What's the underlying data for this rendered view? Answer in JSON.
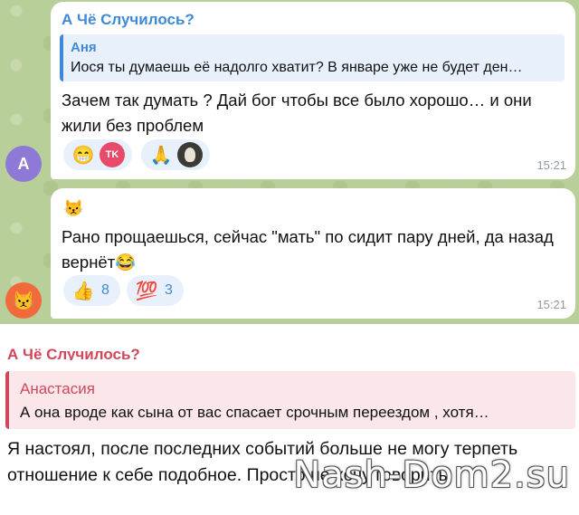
{
  "top_chat": {
    "message1": {
      "sender": "А Чё Случилось?",
      "reply_to_name": "Аня",
      "reply_to_text": "Иося ты думаешь её надолго хватит? В январе уже не будет ден…",
      "text": "Зачем так думать ? Дай бог чтобы все было хорошо… и они жили без проблем",
      "reactions": [
        {
          "icon": "grinning-face-icon",
          "glyph": "😁"
        },
        {
          "icon": "tk-sticker-icon",
          "glyph": "TK"
        },
        {
          "icon": "folded-hands-icon",
          "glyph": "🙏"
        },
        {
          "icon": "user-photo-icon",
          "glyph": ""
        }
      ],
      "time": "15:21",
      "avatar_letter": "A"
    },
    "message2": {
      "top_emoji": "😾",
      "text": "Рано прощаешься, сейчас \"мать\" по сидит пару дней, да назад вернёт😂",
      "reactions": [
        {
          "icon": "thumbs-up-icon",
          "glyph": "👍",
          "count": "8"
        },
        {
          "icon": "hundred-points-icon",
          "glyph": "💯",
          "count": "3"
        }
      ],
      "time": "15:21",
      "avatar_glyph": "😾"
    }
  },
  "bottom_chat": {
    "sender": "А Чё Случилось?",
    "reply_to_name": "Анастасия",
    "reply_to_text": "А она вроде как сына от вас спасает срочным переездом , хотя…",
    "text": "Я настоял, после последних событий больше не могу терпеть отношение к себе подобное. Просто не хочу говорить"
  },
  "watermark": "Nash-Dom2.su",
  "colors": {
    "chat_bg": "#b9cf9a",
    "accent_blue": "#3f8ad6",
    "accent_red": "#d0475b"
  }
}
